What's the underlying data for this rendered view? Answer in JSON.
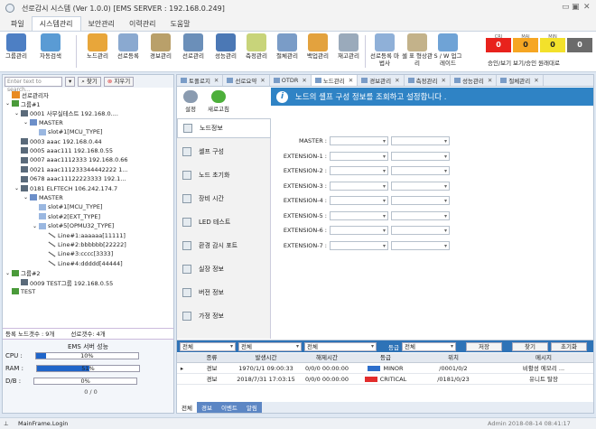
{
  "window": {
    "title": "선로감시 시스템 (Ver 1.0.0) [EMS SERVER : 192.168.0.249]"
  },
  "menu": {
    "tabs": [
      "파일",
      "시스템관리",
      "보안관리",
      "이력관리",
      "도움말"
    ],
    "active_index": 1
  },
  "ribbon": {
    "buttons": [
      {
        "label": "그룹관리",
        "icon": "group-icon",
        "color": "#4d7fc4"
      },
      {
        "label": "자동검색",
        "icon": "network-search-icon",
        "color": "#5a9bd4"
      },
      {
        "label": "노드관리",
        "icon": "folder-node-icon",
        "color": "#e8a63a"
      },
      {
        "label": "선로등록",
        "icon": "document-register-icon",
        "color": "#8aa9d0"
      },
      {
        "label": "경보관리",
        "icon": "alarm-manage-icon",
        "color": "#b9a06a"
      },
      {
        "label": "선로관리",
        "icon": "line-manage-icon",
        "color": "#6b8fb9"
      },
      {
        "label": "성능관리",
        "icon": "gauge-icon",
        "color": "#4b78b5"
      },
      {
        "label": "측정관리",
        "icon": "measure-icon",
        "color": "#c8d47a"
      },
      {
        "label": "절체관리",
        "icon": "switch-chart-icon",
        "color": "#7a9cc7"
      },
      {
        "label": "백업관리",
        "icon": "backup-folder-icon",
        "color": "#e3a23e"
      },
      {
        "label": "재고관리",
        "icon": "inventory-icon",
        "color": "#9aaabb"
      },
      {
        "label": "선로등록 마법사",
        "icon": "wizard-icon",
        "color": "#8fb0d8"
      },
      {
        "label": "셀 표 형상관리",
        "icon": "shelf-icon",
        "color": "#c3b28a"
      },
      {
        "label": "S / W 업그레이드",
        "icon": "upgrade-globe-icon",
        "color": "#6fa3d6"
      }
    ],
    "alarm_labels": [
      "승인/보기",
      "보기/승인",
      "원래대로"
    ],
    "alarm_counters": [
      {
        "label": "CRI",
        "value": "0",
        "bg": "#e8221c",
        "fg": "#ffffff"
      },
      {
        "label": "MAJ",
        "value": "0",
        "bg": "#f6a623",
        "fg": "#222222"
      },
      {
        "label": "MIN",
        "value": "0",
        "bg": "#f3e12b",
        "fg": "#222222"
      },
      {
        "label": "",
        "value": "0",
        "bg": "#6b6b6b",
        "fg": "#ffffff"
      }
    ]
  },
  "left": {
    "search_placeholder": "Enter text to search...",
    "find_label": "찾기",
    "clear_label": "지우기",
    "tree": [
      {
        "text": "선로관리자",
        "icon": "h",
        "depth": 0,
        "arrow": ""
      },
      {
        "text": "그룹#1",
        "icon": "g",
        "depth": 0,
        "arrow": "v"
      },
      {
        "text": "0001 사무실테스트 192.168.0....",
        "icon": "s",
        "depth": 1,
        "arrow": "v"
      },
      {
        "text": "MASTER",
        "icon": "b",
        "depth": 2,
        "arrow": "v"
      },
      {
        "text": "slot#1[MCU_TYPE]",
        "icon": "sl",
        "depth": 3,
        "arrow": ""
      },
      {
        "text": "0003 aaac 192.168.0.44",
        "icon": "s",
        "depth": 1,
        "arrow": ""
      },
      {
        "text": "0005 aaac111 192.168.0.55",
        "icon": "s",
        "depth": 1,
        "arrow": ""
      },
      {
        "text": "0007 aaac1112333 192.168.0.66",
        "icon": "s",
        "depth": 1,
        "arrow": ""
      },
      {
        "text": "0021 aaac111233344442222 1...",
        "icon": "s",
        "depth": 1,
        "arrow": ""
      },
      {
        "text": "0678 aaac11122223333 192.1...",
        "icon": "s",
        "depth": 1,
        "arrow": ""
      },
      {
        "text": "0181 ELFTECH 106.242.174.7",
        "icon": "s",
        "depth": 1,
        "arrow": "v"
      },
      {
        "text": "MASTER",
        "icon": "b",
        "depth": 2,
        "arrow": "v"
      },
      {
        "text": "slot#1[MCU_TYPE]",
        "icon": "sl",
        "depth": 3,
        "arrow": ""
      },
      {
        "text": "slot#2[EXT_TYPE]",
        "icon": "sl",
        "depth": 3,
        "arrow": ""
      },
      {
        "text": "slot#5[OPMU32_TYPE]",
        "icon": "sl",
        "depth": 3,
        "arrow": "v"
      },
      {
        "text": "Line#1:aaaaaa[11111]",
        "icon": "l",
        "depth": 4,
        "arrow": ""
      },
      {
        "text": "Line#2:bbbbbb[22222]",
        "icon": "l",
        "depth": 4,
        "arrow": ""
      },
      {
        "text": "Line#3:cccc[3333]",
        "icon": "l",
        "depth": 4,
        "arrow": ""
      },
      {
        "text": "Line#4:ddddd[44444]",
        "icon": "l",
        "depth": 4,
        "arrow": ""
      },
      {
        "text": "그룹#2",
        "icon": "g",
        "depth": 0,
        "arrow": "v"
      },
      {
        "text": "0009 TEST그룹 192.168.0.55",
        "icon": "s",
        "depth": 1,
        "arrow": ""
      },
      {
        "text": "TEST",
        "icon": "g",
        "depth": 0,
        "arrow": ""
      }
    ],
    "node_count": "등록 노드갯수 : 9개",
    "line_count": "선로갯수: 4개",
    "perf": {
      "title": "EMS 서버 성능",
      "cpu_label": "CPU :",
      "cpu_value": "10%",
      "cpu_pct": 10,
      "ram_label": "RAM :",
      "ram_value": "51%",
      "ram_pct": 51,
      "db_label": "D/B :",
      "db_value": "0%",
      "db_pct": 0,
      "db_count": "0 / 0"
    }
  },
  "tabs": [
    {
      "label": "토폴로지",
      "icon": "topology-icon",
      "active": false
    },
    {
      "label": "선로요약",
      "icon": "line-summary-icon",
      "active": false
    },
    {
      "label": "OTDR",
      "icon": "otdr-icon",
      "active": false
    },
    {
      "label": "노드관리",
      "icon": "node-manage-icon",
      "active": true
    },
    {
      "label": "경보관리",
      "icon": "alarm-icon",
      "active": false
    },
    {
      "label": "측정관리",
      "icon": "measure-icon",
      "active": false
    },
    {
      "label": "성능관리",
      "icon": "performance-icon",
      "active": false
    },
    {
      "label": "절체관리",
      "icon": "switch-icon",
      "active": false
    }
  ],
  "toolbar": {
    "settings_label": "설정",
    "refresh_label": "새로고침"
  },
  "info_message": "노드의 셸프 구성 정보를 조회하고 설정합니다 .",
  "left_menu": [
    {
      "label": "노드정보",
      "icon": "node-info-icon",
      "active": true
    },
    {
      "label": "셸프 구성",
      "icon": "shelf-config-icon",
      "active": false
    },
    {
      "label": "노드 초기화",
      "icon": "node-reset-icon",
      "active": false
    },
    {
      "label": "장비 시간",
      "icon": "clock-icon",
      "active": false
    },
    {
      "label": "LED 테스트",
      "icon": "led-test-icon",
      "active": false
    },
    {
      "label": "환경 감시 포트",
      "icon": "env-port-icon",
      "active": false
    },
    {
      "label": "실장 정보",
      "icon": "mount-info-icon",
      "active": false
    },
    {
      "label": "버전 정보",
      "icon": "version-icon",
      "active": false
    },
    {
      "label": "가정 정보",
      "icon": "home-info-icon",
      "active": false
    }
  ],
  "form": {
    "rows": [
      "MASTER :",
      "EXTENSION-1 :",
      "EXTENSION-2 :",
      "EXTENSION-3 :",
      "EXTENSION-4 :",
      "EXTENSION-5 :",
      "EXTENSION-6 :",
      "EXTENSION-7 :"
    ]
  },
  "alarm_filter": {
    "sel1": "전체",
    "sel2": "전체",
    "sel3": "전체",
    "grade_label": "등급",
    "sel4": "전체",
    "save": "저장",
    "find": "찾기",
    "reset": "초기화"
  },
  "alarm_grid": {
    "headers": [
      "종류",
      "발생시간",
      "해제시간",
      "등급",
      "위치",
      "메시지"
    ],
    "rows": [
      {
        "type": "경보",
        "occur": "1970/1/1 09:00:33",
        "clear": "0/0/0 00:00:00",
        "grade": "MINOR",
        "grade_color": "#2c6ecb",
        "loc": "/0001/0/2",
        "msg": "비활성 에모리 ..."
      },
      {
        "type": "경보",
        "occur": "2018/7/31 17:03:15",
        "clear": "0/0/0 00:00:00",
        "grade": "CRITICAL",
        "grade_color": "#e22d2d",
        "loc": "/0181/0/23",
        "msg": "유니트 탈장"
      }
    ]
  },
  "bottom_tabs": [
    {
      "label": "전체",
      "active": true
    },
    {
      "label": "경보",
      "active": false
    },
    {
      "label": "이벤트",
      "active": false
    },
    {
      "label": "알림",
      "active": false
    }
  ],
  "status": {
    "left": "MainFrame.Login",
    "right": "Admin   2018-08-14 08:41:17"
  }
}
